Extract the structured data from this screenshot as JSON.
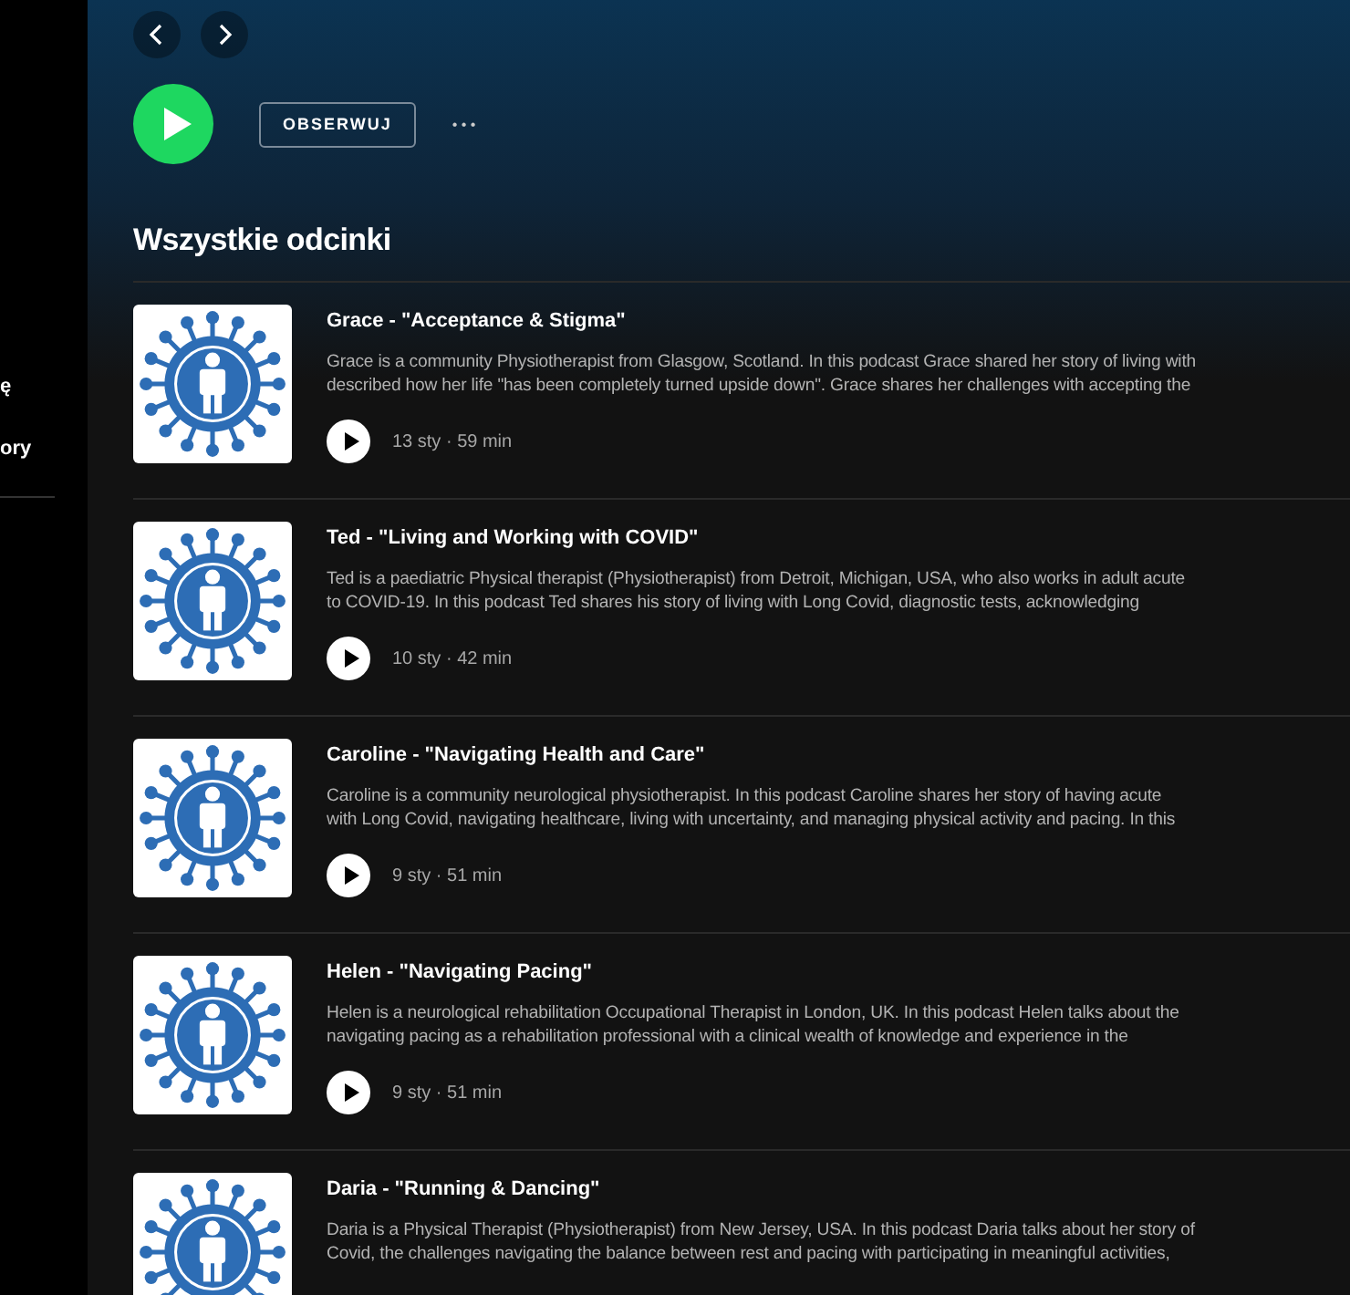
{
  "sidebar": {
    "items": [
      {
        "label": "ę"
      },
      {
        "label": "ory"
      }
    ]
  },
  "header": {
    "follow_button": "OBSERWUJ",
    "more_button": "• • •"
  },
  "section_title": "Wszystkie odcinki",
  "episodes": [
    {
      "title": "Grace - \"Acceptance & Stigma\"",
      "description": [
        "Grace is a community Physiotherapist from Glasgow, Scotland. In this podcast Grace shared her story of living with",
        "described how her life \"has been completely turned upside down\". Grace shares her challenges with accepting the"
      ],
      "meta": "13 sty · 59 min"
    },
    {
      "title": "Ted - \"Living and Working with COVID\"",
      "description": [
        "Ted is a paediatric Physical therapist (Physiotherapist) from Detroit, Michigan, USA, who also works in adult acute",
        "to COVID-19. In this podcast Ted shares his story of living with Long Covid, diagnostic tests, acknowledging"
      ],
      "meta": "10 sty · 42 min"
    },
    {
      "title": "Caroline - \"Navigating Health and Care\"",
      "description": [
        "Caroline is a community neurological physiotherapist. In this podcast Caroline shares her story of having acute",
        "with Long Covid, navigating healthcare, living with uncertainty, and managing physical activity and pacing. In this"
      ],
      "meta": "9 sty · 51 min"
    },
    {
      "title": "Helen - \"Navigating Pacing\"",
      "description": [
        "Helen is a neurological rehabilitation Occupational Therapist in London, UK. In this podcast Helen talks about the",
        "navigating pacing as a rehabilitation professional with a clinical wealth of knowledge and experience in the"
      ],
      "meta": "9 sty · 51 min"
    },
    {
      "title": "Daria - \"Running & Dancing\"",
      "description": [
        "Daria is a Physical Therapist (Physiotherapist) from New Jersey, USA. In this podcast Daria talks about her story of",
        "Covid, the challenges navigating the balance between rest and pacing with participating in meaningful activities,"
      ]
    }
  ]
}
